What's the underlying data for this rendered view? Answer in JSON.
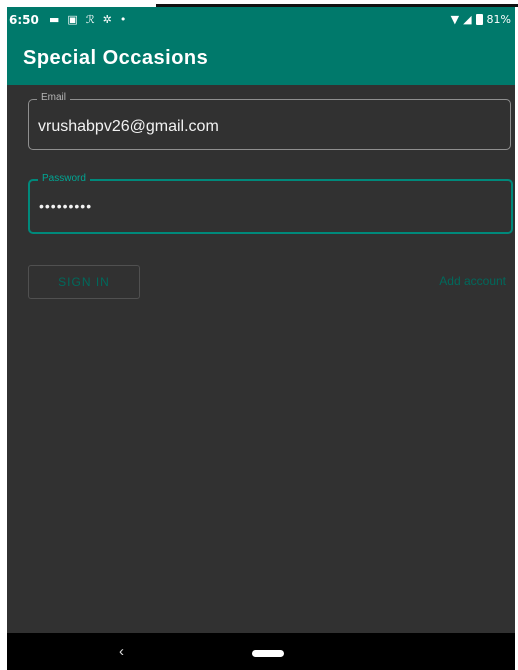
{
  "status_bar": {
    "time": "6:50",
    "notification_icons": [
      "message-icon",
      "image-icon",
      "translate-icon",
      "settings-icon",
      "dot-icon"
    ],
    "battery": "81%"
  },
  "app": {
    "title": "Special Occasions",
    "accent": "#00796b"
  },
  "form": {
    "email_label": "Email",
    "email_value": "vrushabpv26@gmail.com",
    "password_label": "Password",
    "password_value": "•••••••••",
    "signin_label": "SIGN IN",
    "add_account_label": "Add account"
  },
  "nav": {
    "back_glyph": "‹"
  }
}
